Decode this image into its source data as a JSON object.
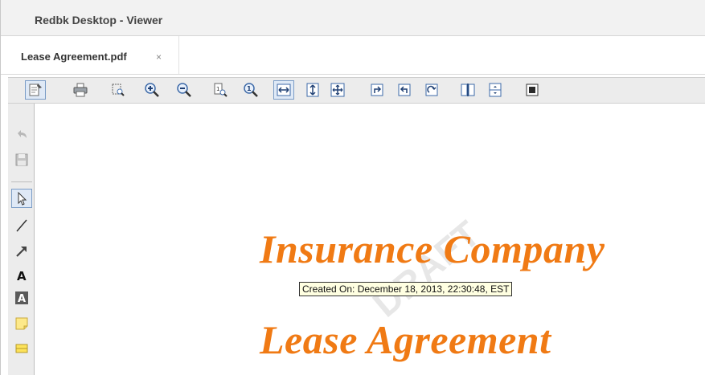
{
  "window": {
    "title": "Redbk Desktop - Viewer"
  },
  "tabs": [
    {
      "label": "Lease Agreement.pdf",
      "close_glyph": "×"
    }
  ],
  "toolbar": {
    "buttons": [
      {
        "name": "edit-icon"
      },
      {
        "name": "print-icon"
      },
      {
        "name": "marquee-zoom-icon"
      },
      {
        "name": "zoom-in-icon"
      },
      {
        "name": "zoom-out-icon"
      },
      {
        "name": "actual-size-icon"
      },
      {
        "name": "zoom-one-icon"
      },
      {
        "name": "fit-width-icon"
      },
      {
        "name": "fit-height-icon"
      },
      {
        "name": "fit-page-icon"
      },
      {
        "name": "rotate-right-icon"
      },
      {
        "name": "rotate-left-icon"
      },
      {
        "name": "rotate-clockwise-icon"
      },
      {
        "name": "two-page-icon"
      },
      {
        "name": "scroll-mode-icon"
      },
      {
        "name": "fullscreen-icon"
      }
    ]
  },
  "left_tools": [
    {
      "name": "undo-icon"
    },
    {
      "name": "save-icon"
    },
    {
      "name": "select-arrow-icon"
    },
    {
      "name": "line-icon"
    },
    {
      "name": "arrow-icon"
    },
    {
      "name": "text-icon"
    },
    {
      "name": "text-box-icon"
    },
    {
      "name": "sticky-note-icon"
    },
    {
      "name": "highlight-icon"
    }
  ],
  "document": {
    "heading": "Insurance Company",
    "subheading": "Lease Agreement",
    "watermark": "DRAFT",
    "tooltip": "Created On: December 18, 2013, 22:30:48, EST"
  },
  "colors": {
    "accent": "#f07a14",
    "toolbar_bg": "#ececec",
    "pressed_border": "#7a9cc6"
  }
}
